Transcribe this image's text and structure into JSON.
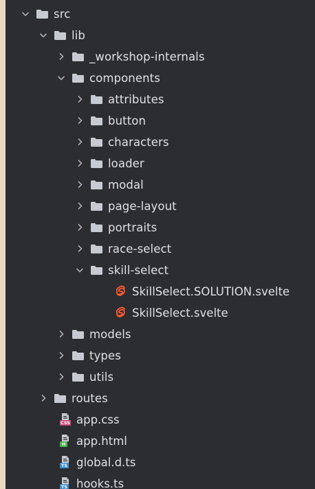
{
  "tree": {
    "src": "src",
    "lib": "lib",
    "workshop_internals": "_workshop-internals",
    "components": "components",
    "attributes": "attributes",
    "button": "button",
    "characters": "characters",
    "loader": "loader",
    "modal": "modal",
    "page_layout": "page-layout",
    "portraits": "portraits",
    "race_select": "race-select",
    "skill_select": "skill-select",
    "skill_select_solution": "SkillSelect.SOLUTION.svelte",
    "skill_select_file": "SkillSelect.svelte",
    "models": "models",
    "types": "types",
    "utils": "utils",
    "routes": "routes",
    "app_css": "app.css",
    "app_html": "app.html",
    "global_d_ts": "global.d.ts",
    "hooks_ts": "hooks.ts"
  },
  "badges": {
    "css": "CSS",
    "html": "H",
    "ts": "TS"
  },
  "colors": {
    "panel_bg": "#2b2d30",
    "text": "#dfe1e5",
    "folder": "#c7cbd1",
    "chevron": "#a9adb3",
    "svelte": "#ff5a32",
    "css_badge": "#c74a76",
    "html_badge": "#4caf50",
    "ts_badge": "#3d8ccf"
  }
}
